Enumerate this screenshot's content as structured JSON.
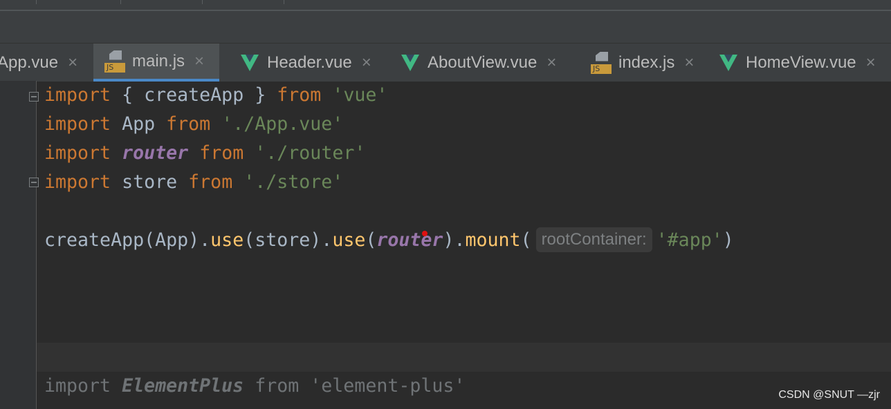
{
  "tabs": [
    {
      "label": "App.vue",
      "icon": "vue-icon",
      "active": false
    },
    {
      "label": "main.js",
      "icon": "js-icon",
      "active": true
    },
    {
      "label": "Header.vue",
      "icon": "vue-icon",
      "active": false
    },
    {
      "label": "AboutView.vue",
      "icon": "vue-icon",
      "active": false
    },
    {
      "label": "index.js",
      "icon": "js-icon",
      "active": false
    },
    {
      "label": "HomeView.vue",
      "icon": "vue-icon",
      "active": false
    }
  ],
  "close_glyph": "×",
  "js_badge": "JS",
  "colors": {
    "keyword": "#cc7832",
    "string": "#6a8759",
    "import_name": "#9876aa",
    "function": "#ffc66d",
    "accent": "#4a88c7",
    "vue": "#41b883"
  },
  "code": [
    [
      {
        "t": "import",
        "c": "kw"
      },
      {
        "t": " { createApp } ",
        "c": "plain"
      },
      {
        "t": "from",
        "c": "kw"
      },
      {
        "t": " ",
        "c": "plain"
      },
      {
        "t": "'vue'",
        "c": "str"
      }
    ],
    [
      {
        "t": "import",
        "c": "kw"
      },
      {
        "t": " App ",
        "c": "plain"
      },
      {
        "t": "from",
        "c": "kw"
      },
      {
        "t": " ",
        "c": "plain"
      },
      {
        "t": "'./App.vue'",
        "c": "str"
      }
    ],
    [
      {
        "t": "import",
        "c": "kw"
      },
      {
        "t": " ",
        "c": "plain"
      },
      {
        "t": "router",
        "c": "ital"
      },
      {
        "t": " ",
        "c": "plain"
      },
      {
        "t": "from",
        "c": "kw"
      },
      {
        "t": " ",
        "c": "plain"
      },
      {
        "t": "'./router'",
        "c": "str"
      }
    ],
    [
      {
        "t": "import",
        "c": "kw"
      },
      {
        "t": " store ",
        "c": "plain"
      },
      {
        "t": "from",
        "c": "kw"
      },
      {
        "t": " ",
        "c": "plain"
      },
      {
        "t": "'./store'",
        "c": "str"
      }
    ],
    [],
    [
      {
        "t": "createApp(App).",
        "c": "plain"
      },
      {
        "t": "use",
        "c": "fn"
      },
      {
        "t": "(store).",
        "c": "plain"
      },
      {
        "t": "use",
        "c": "fn"
      },
      {
        "t": "(",
        "c": "plain"
      },
      {
        "t": "router",
        "c": "ital"
      },
      {
        "t": ").",
        "c": "plain"
      },
      {
        "t": "mount",
        "c": "fn"
      },
      {
        "t": "(",
        "c": "plain"
      },
      {
        "t": "rootContainer:",
        "c": "hint"
      },
      {
        "t": "'#app'",
        "c": "str"
      },
      {
        "t": ")",
        "c": "plain"
      }
    ]
  ],
  "ghost_code": [
    {
      "t": "import ",
      "c": "ghost"
    },
    {
      "t": "ElementPlus",
      "c": "ghost ital"
    },
    {
      "t": " from 'element-plus'",
      "c": "ghost"
    }
  ],
  "watermark": "CSDN @SNUT —zjr"
}
